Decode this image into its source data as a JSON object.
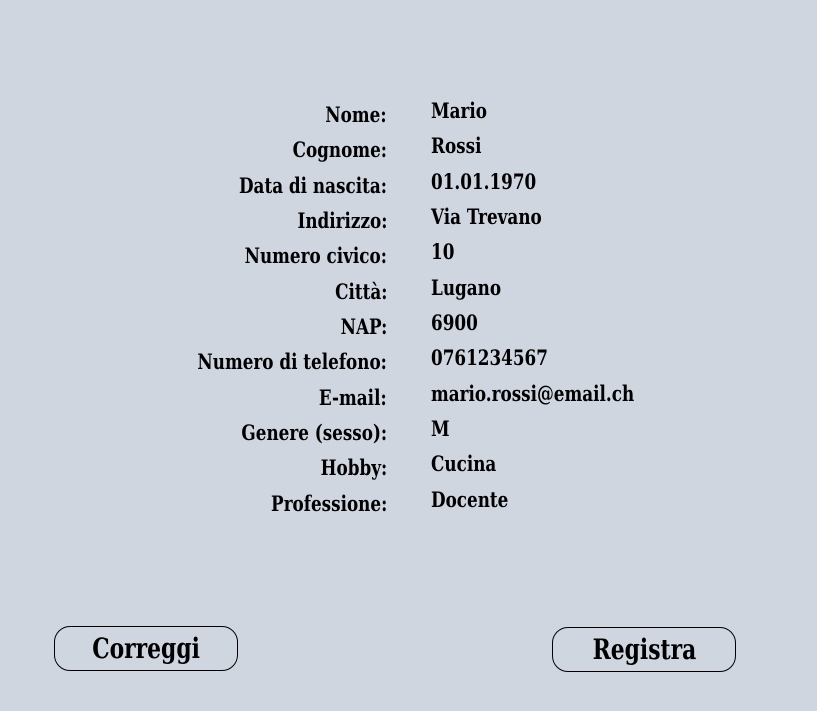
{
  "summary": {
    "rows": [
      {
        "label": "Nome:",
        "value": "Mario"
      },
      {
        "label": "Cognome:",
        "value": "Rossi"
      },
      {
        "label": "Data di nascita:",
        "value": "01.01.1970"
      },
      {
        "label": "Indirizzo:",
        "value": "Via Trevano"
      },
      {
        "label": "Numero civico:",
        "value": "10"
      },
      {
        "label": "Città:",
        "value": "Lugano"
      },
      {
        "label": "NAP:",
        "value": "6900"
      },
      {
        "label": "Numero di telefono:",
        "value": "0761234567"
      },
      {
        "label": "E-mail:",
        "value": "mario.rossi@email.ch"
      },
      {
        "label": "Genere (sesso):",
        "value": "M"
      },
      {
        "label": "Hobby:",
        "value": "Cucina"
      },
      {
        "label": "Professione:",
        "value": "Docente"
      }
    ]
  },
  "buttons": {
    "correct_label": "Correggi",
    "register_label": "Registra"
  }
}
